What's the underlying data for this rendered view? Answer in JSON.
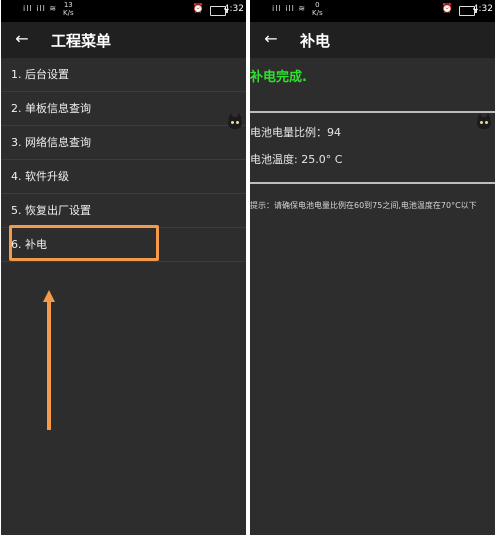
{
  "left": {
    "status": {
      "speed_value": "13",
      "speed_unit": "K/s",
      "time": "4:32"
    },
    "title": "工程菜单",
    "items": [
      {
        "label": "1. 后台设置"
      },
      {
        "label": "2. 单板信息查询"
      },
      {
        "label": "3. 网络信息查询"
      },
      {
        "label": "4. 软件升级"
      },
      {
        "label": "5. 恢复出厂设置"
      },
      {
        "label": "6. 补电"
      }
    ],
    "annotation_color": "#f39a4b"
  },
  "right": {
    "status": {
      "speed_value": "0",
      "speed_unit": "K/s",
      "time": "4:32"
    },
    "title": "补电",
    "done_text": "补电完成.",
    "battery_level": "电池电量比例：94",
    "battery_temp": "电池温度: 25.0° C",
    "tip": "提示：请确保电池电量比例在60到75之间,电池温度在70°C以下",
    "accent": "#2fe02f"
  }
}
